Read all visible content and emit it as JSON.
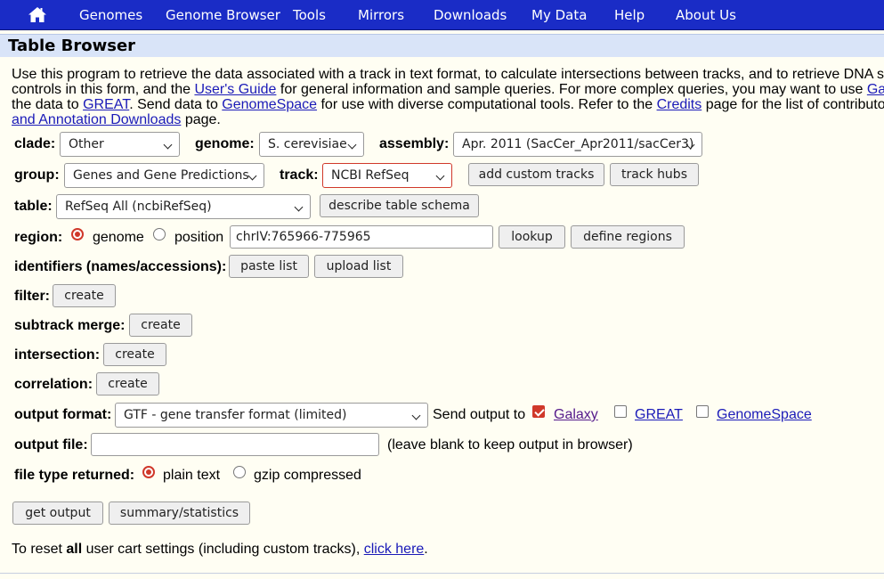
{
  "nav": {
    "items": [
      "Genomes",
      "Genome Browser",
      "Tools",
      "Mirrors",
      "Downloads",
      "My Data",
      "Help",
      "About Us"
    ]
  },
  "title": "Table Browser",
  "intro": {
    "line1": "Use this program to retrieve the data associated with a track in text format, to calculate intersections between tracks, and to retrieve DNA seq",
    "line2_a": "controls in this form, and the ",
    "line2_link": "User's Guide",
    "line2_b": " for general information and sample queries. For more complex queries, you may want to use ",
    "line2_link2": "Gala",
    "line3_a": "the data to ",
    "line3_link1": "GREAT",
    "line3_b": ". Send data to ",
    "line3_link2": "GenomeSpace",
    "line3_c": " for use with diverse computational tools. Refer to the ",
    "line3_link3": "Credits",
    "line3_d": " page for the list of contributors",
    "line4_link": "and Annotation Downloads",
    "line4_b": " page."
  },
  "form": {
    "clade_label": "clade:",
    "clade_value": "Other",
    "genome_label": "genome:",
    "genome_value": "S. cerevisiae",
    "assembly_label": "assembly:",
    "assembly_value": "Apr. 2011 (SacCer_Apr2011/sacCer3)",
    "group_label": "group:",
    "group_value": "Genes and Gene Predictions",
    "track_label": "track:",
    "track_value": "NCBI RefSeq",
    "add_custom_tracks": "add custom tracks",
    "track_hubs": "track hubs",
    "table_label": "table:",
    "table_value": "RefSeq All (ncbiRefSeq)",
    "describe_schema": "describe table schema",
    "region_label": "region:",
    "region_genome": "genome",
    "region_position": "position",
    "position_value": "chrIV:765966-775965",
    "lookup": "lookup",
    "define_regions": "define regions",
    "identifiers_label": "identifiers (names/accessions):",
    "paste_list": "paste list",
    "upload_list": "upload list",
    "filter_label": "filter:",
    "subtrack_merge_label": "subtrack merge:",
    "intersection_label": "intersection:",
    "correlation_label": "correlation:",
    "create": "create",
    "output_format_label": "output format:",
    "output_format_value": "GTF - gene transfer format (limited)",
    "send_output_to": "Send output to",
    "galaxy": "Galaxy",
    "great": "GREAT",
    "genomespace": "GenomeSpace",
    "output_file_label": "output file:",
    "output_file_value": "",
    "output_file_hint": "(leave blank to keep output in browser)",
    "file_type_label": "file type returned:",
    "plain_text": "plain text",
    "gzip": "gzip compressed",
    "get_output": "get output",
    "summary_statistics": "summary/statistics"
  },
  "reset": {
    "text_a": "To reset ",
    "text_bold": "all",
    "text_b": " user cart settings (including custom tracks), ",
    "link": "click here",
    "text_c": "."
  },
  "colors": {
    "navbar": "#1a2cc6",
    "background": "#fffef3",
    "titlebar": "#d9e4f8",
    "accent": "#d0382a",
    "link": "#1a1ab8"
  }
}
